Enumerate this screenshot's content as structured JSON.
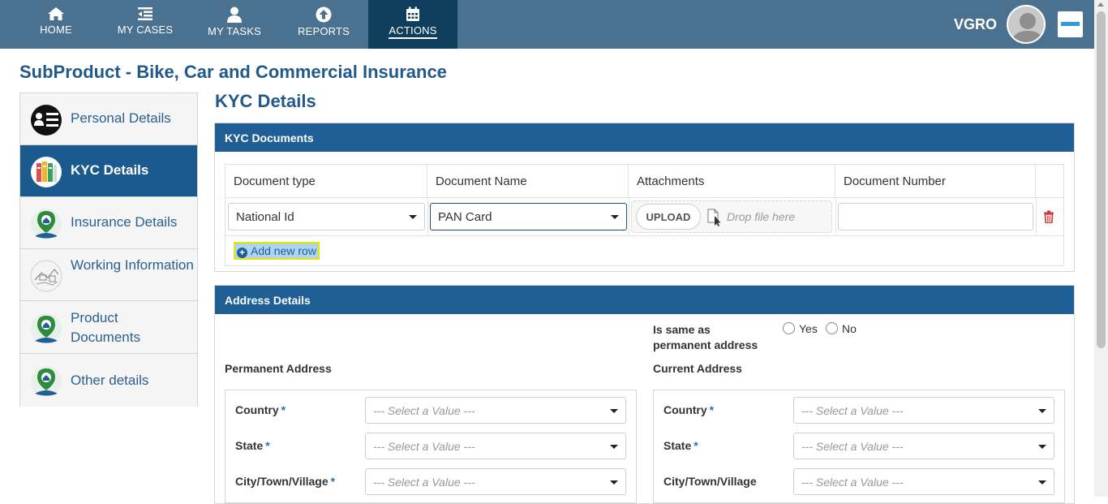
{
  "nav": {
    "items": [
      {
        "label": "HOME",
        "icon": "home-icon"
      },
      {
        "label": "MY CASES",
        "icon": "list-icon"
      },
      {
        "label": "MY TASKS",
        "icon": "person-icon"
      },
      {
        "label": "REPORTS",
        "icon": "upload-circle-icon"
      },
      {
        "label": "ACTIONS",
        "icon": "calendar-icon",
        "active": true
      }
    ],
    "user": "VGRO"
  },
  "page_title": "SubProduct - Bike, Car and Commercial Insurance",
  "sidebar": {
    "items": [
      {
        "label": "Personal Details"
      },
      {
        "label": "KYC Details",
        "active": true
      },
      {
        "label": "Insurance Details"
      },
      {
        "label": "Working Information"
      },
      {
        "label": "Product Documents"
      },
      {
        "label": "Other details"
      }
    ]
  },
  "section_title": "KYC Details",
  "kyc": {
    "panel_title": "KYC Documents",
    "columns": [
      "Document type",
      "Document Name",
      "Attachments",
      "Document Number"
    ],
    "row": {
      "document_type": "National Id",
      "document_name": "PAN Card",
      "upload_label": "UPLOAD",
      "drop_text": "Drop file here",
      "document_number": ""
    },
    "add_row_label": "Add new row"
  },
  "address": {
    "panel_title": "Address Details",
    "same_as_label": "Is same as permanent address",
    "yes_label": "Yes",
    "no_label": "No",
    "permanent_title": "Permanent Address",
    "current_title": "Current Address",
    "permanent_fields": [
      {
        "label": "Country",
        "required": "*",
        "placeholder": "--- Select a Value ---"
      },
      {
        "label": "State",
        "required": "*",
        "placeholder": "--- Select a Value ---"
      },
      {
        "label": "City/Town/Village",
        "required": "*",
        "placeholder": "--- Select a Value ---"
      }
    ],
    "current_fields": [
      {
        "label": "Country",
        "required": "*",
        "placeholder": "--- Select a Value ---"
      },
      {
        "label": "State",
        "required": "*",
        "placeholder": "--- Select a Value ---"
      },
      {
        "label": "City/Town/Village",
        "required": "",
        "placeholder": "--- Select a Value ---"
      }
    ]
  },
  "colors": {
    "topbar": "#4a7290",
    "active_nav": "#0f3d5c",
    "panel_head": "#1f5f96",
    "title": "#23598a",
    "highlight": "#e6e600"
  }
}
